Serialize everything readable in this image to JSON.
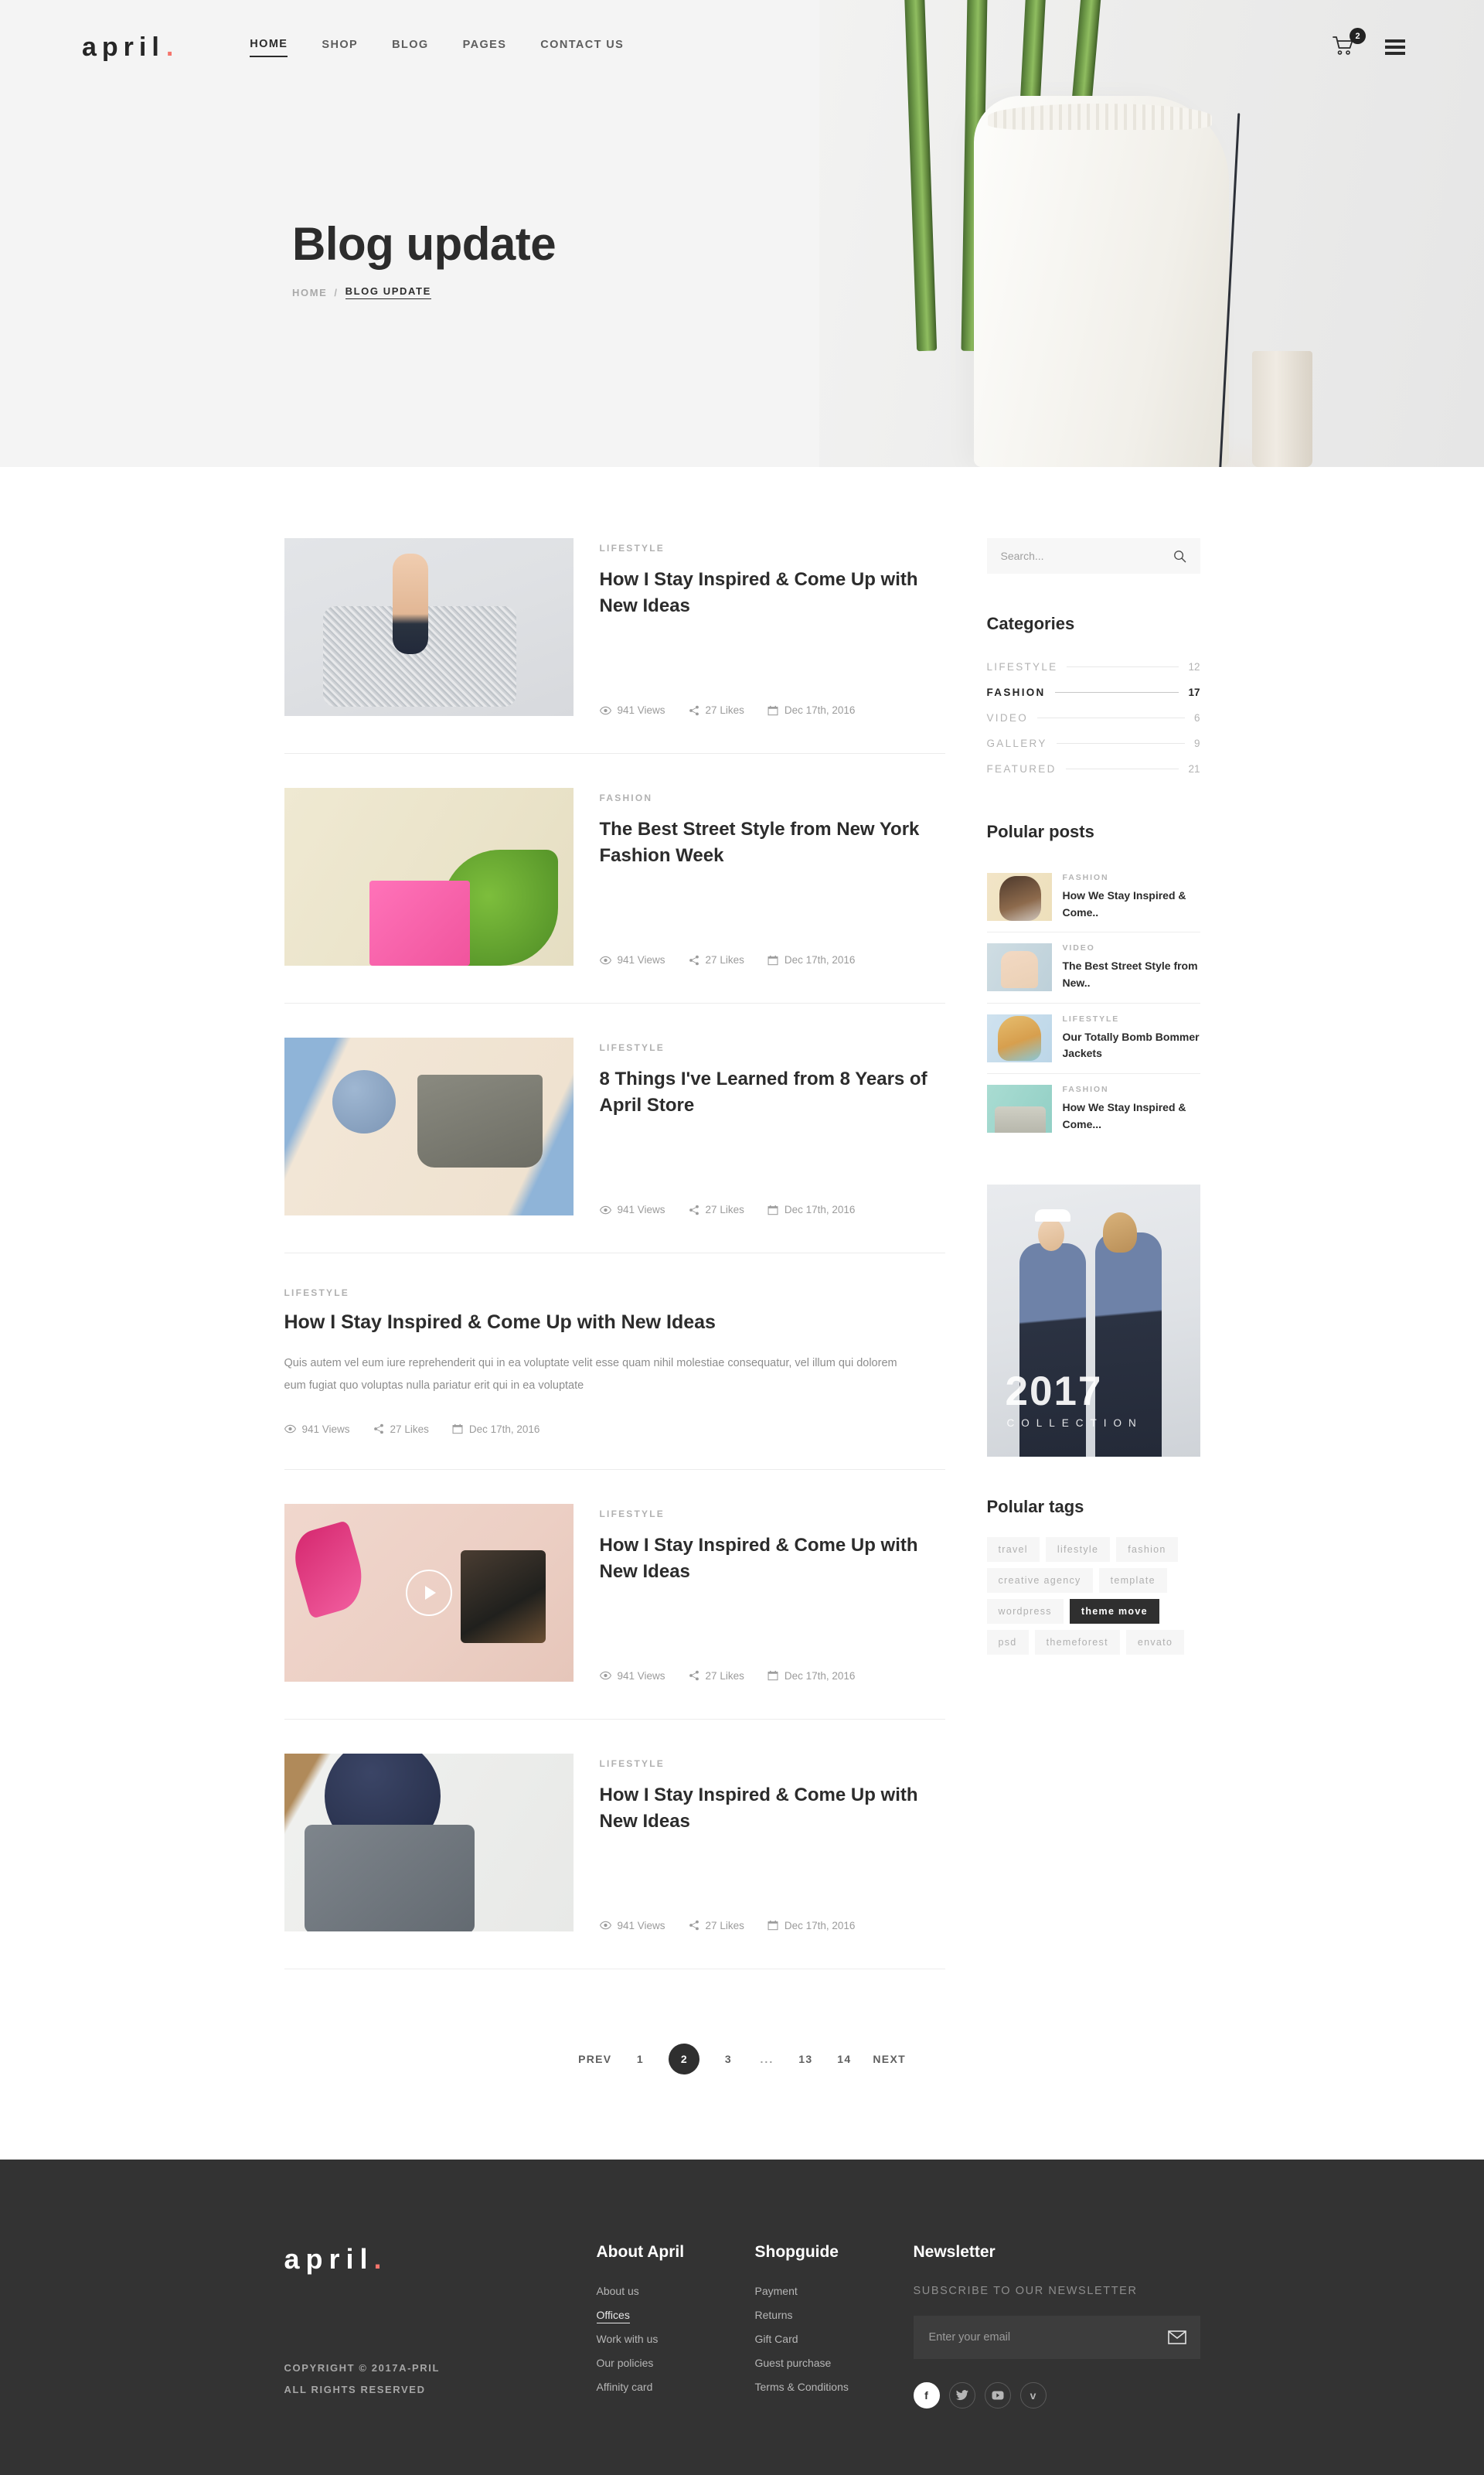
{
  "header": {
    "logo": "april",
    "logo_dot": ".",
    "nav": [
      {
        "label": "HOME",
        "active": true
      },
      {
        "label": "SHOP",
        "active": false
      },
      {
        "label": "BLOG",
        "active": false
      },
      {
        "label": "PAGES",
        "active": false
      },
      {
        "label": "CONTACT US",
        "active": false
      }
    ],
    "cart_count": "2"
  },
  "hero": {
    "title": "Blog update",
    "breadcrumb_home": "HOME",
    "breadcrumb_sep": "/",
    "breadcrumb_current": "BLOG UPDATE"
  },
  "posts": [
    {
      "category": "LIFESTYLE",
      "title": "How I Stay Inspired & Come Up with New Ideas",
      "views": "941 Views",
      "likes": "27 Likes",
      "date": "Dec 17th, 2016",
      "layout": "image",
      "art": "img-shoes"
    },
    {
      "category": "FASHION",
      "title": "The Best Street Style from New York Fashion Week",
      "views": "941 Views",
      "likes": "27 Likes",
      "date": "Dec 17th, 2016",
      "layout": "image",
      "art": "img-pink"
    },
    {
      "category": "LIFESTYLE",
      "title": "8 Things I've Learned from 8 Years of April Store",
      "views": "941 Views",
      "likes": "27 Likes",
      "date": "Dec 17th, 2016",
      "layout": "image",
      "art": "img-flat"
    },
    {
      "category": "LIFESTYLE",
      "title": "How I Stay Inspired & Come Up with New Ideas",
      "excerpt": "Quis autem vel eum iure reprehenderit qui in ea voluptate velit esse quam nihil molestiae consequatur, vel illum qui dolorem eum fugiat quo voluptas nulla pariatur erit qui in ea voluptate",
      "views": "941 Views",
      "likes": "27 Likes",
      "date": "Dec 17th, 2016",
      "layout": "text"
    },
    {
      "category": "LIFESTYLE",
      "title": "How I Stay Inspired & Come Up with New Ideas",
      "views": "941 Views",
      "likes": "27 Likes",
      "date": "Dec 17th, 2016",
      "layout": "video",
      "art": "img-heels"
    },
    {
      "category": "LIFESTYLE",
      "title": "How I Stay Inspired & Come Up with New Ideas",
      "views": "941 Views",
      "likes": "27 Likes",
      "date": "Dec 17th, 2016",
      "layout": "image",
      "art": "img-helmet"
    }
  ],
  "sidebar": {
    "search_placeholder": "Search...",
    "categories_heading": "Categories",
    "categories": [
      {
        "name": "LIFESTYLE",
        "count": "12",
        "active": false
      },
      {
        "name": "FASHION",
        "count": "17",
        "active": true
      },
      {
        "name": "VIDEO",
        "count": "6",
        "active": false
      },
      {
        "name": "GALLERY",
        "count": "9",
        "active": false
      },
      {
        "name": "FEATURED",
        "count": "21",
        "active": false
      }
    ],
    "popular_posts_heading": "Polular posts",
    "popular_posts": [
      {
        "category": "FASHION",
        "title": "How We Stay Inspired & Come..",
        "art": "t-girl"
      },
      {
        "category": "VIDEO",
        "title": "The Best Street Style from New..",
        "art": "t-shoes"
      },
      {
        "category": "LIFESTYLE",
        "title": "Our Totally Bomb Bommer Jackets",
        "art": "t-blonde"
      },
      {
        "category": "FASHION",
        "title": "How We Stay Inspired & Come...",
        "art": "t-seats"
      }
    ],
    "promo_year": "2017",
    "promo_sub": "COLLECTION",
    "tags_heading": "Polular tags",
    "tags": [
      {
        "label": "travel",
        "active": false
      },
      {
        "label": "lifestyle",
        "active": false
      },
      {
        "label": "fashion",
        "active": false
      },
      {
        "label": "creative agency",
        "active": false
      },
      {
        "label": "template",
        "active": false
      },
      {
        "label": "wordpress",
        "active": false
      },
      {
        "label": "theme move",
        "active": true
      },
      {
        "label": "psd",
        "active": false
      },
      {
        "label": "themeforest",
        "active": false
      },
      {
        "label": "envato",
        "active": false
      }
    ]
  },
  "pagination": {
    "prev": "PREV",
    "next": "NEXT",
    "pages": [
      {
        "label": "1",
        "current": false
      },
      {
        "label": "2",
        "current": true
      },
      {
        "label": "3",
        "current": false
      },
      {
        "label": "...",
        "current": false,
        "dots": true
      },
      {
        "label": "13",
        "current": false
      },
      {
        "label": "14",
        "current": false
      }
    ]
  },
  "footer": {
    "logo": "april",
    "logo_dot": ".",
    "copyright_line1": "COPYRIGHT © 2017A-PRIL",
    "copyright_line2": "ALL RIGHTS RESERVED",
    "about_heading": "About April",
    "about_links": [
      {
        "label": "About us",
        "underline": false
      },
      {
        "label": "Offices",
        "underline": true
      },
      {
        "label": "Work with us",
        "underline": false
      },
      {
        "label": "Our policies",
        "underline": false
      },
      {
        "label": "Affinity card",
        "underline": false
      }
    ],
    "shop_heading": "Shopguide",
    "shop_links": [
      {
        "label": "Payment",
        "underline": false
      },
      {
        "label": "Returns",
        "underline": false
      },
      {
        "label": "Gift Card",
        "underline": false
      },
      {
        "label": "Guest purchase",
        "underline": false
      },
      {
        "label": "Terms & Conditions",
        "underline": false
      }
    ],
    "newsletter_heading": "Newsletter",
    "newsletter_sub": "SUBSCRIBE TO OUR NEWSLETTER",
    "email_placeholder": "Enter your email",
    "socials": [
      {
        "name": "facebook",
        "glyph": "f"
      },
      {
        "name": "twitter",
        "glyph": "t"
      },
      {
        "name": "youtube",
        "glyph": "▶"
      },
      {
        "name": "vimeo",
        "glyph": "v"
      }
    ]
  },
  "colors": {
    "accent": "#f5756c",
    "dark": "#333333",
    "text": "#2c2c2c",
    "muted": "#b1b1b1"
  }
}
